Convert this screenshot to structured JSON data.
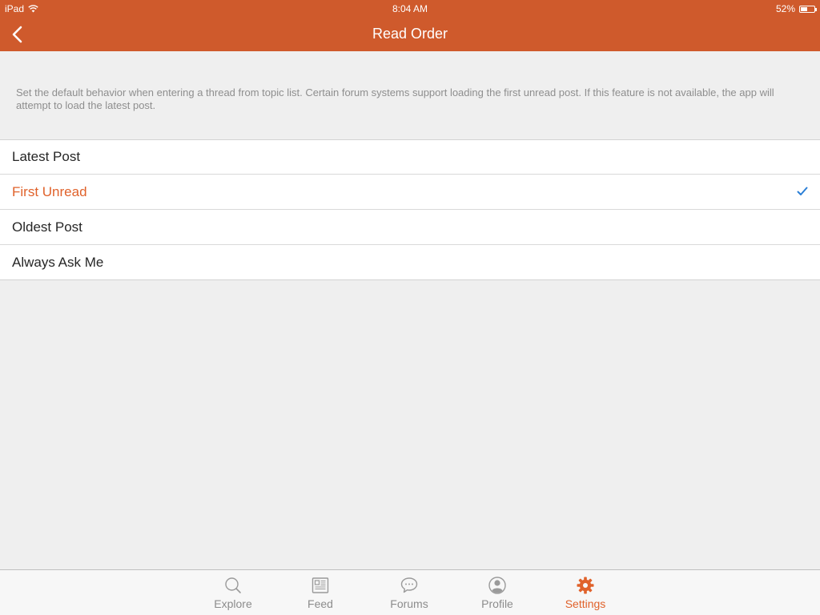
{
  "status": {
    "device": "iPad",
    "time": "8:04 AM",
    "battery": "52%",
    "battery_level": 0.52
  },
  "nav": {
    "title": "Read Order"
  },
  "description": "Set the default behavior when entering a thread from topic list. Certain forum systems support loading the first unread post. If this feature is not available, the app will attempt to load the latest post.",
  "options": [
    {
      "label": "Latest Post",
      "selected": false
    },
    {
      "label": "First Unread",
      "selected": true
    },
    {
      "label": "Oldest Post",
      "selected": false
    },
    {
      "label": "Always Ask Me",
      "selected": false
    }
  ],
  "tabs": [
    {
      "label": "Explore",
      "icon": "search-icon"
    },
    {
      "label": "Feed",
      "icon": "newspaper-icon"
    },
    {
      "label": "Forums",
      "icon": "chat-bubble-icon"
    },
    {
      "label": "Profile",
      "icon": "person-icon"
    },
    {
      "label": "Settings",
      "icon": "gear-icon"
    }
  ],
  "colors": {
    "accent": "#cf5a2c",
    "selected_text": "#e0622b",
    "checkmark": "#2b7fd6"
  }
}
